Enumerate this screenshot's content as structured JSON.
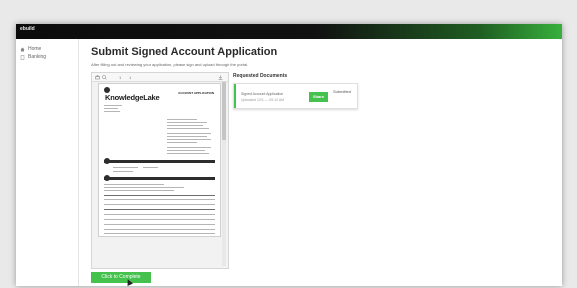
{
  "app": {
    "brand": "ebuild",
    "topbar_center": ""
  },
  "sidebar": {
    "items": [
      {
        "label": "Home",
        "icon": "home-icon"
      },
      {
        "label": "Banking",
        "icon": "document-icon"
      }
    ]
  },
  "page": {
    "title": "Submit Signed Account Application",
    "instructions": "After filling out and reviewing your application, please sign and upload through the portal."
  },
  "viewer": {
    "page_indicator": "1",
    "page_total": "1",
    "zoom": "",
    "toolbar_icons": [
      "print-icon",
      "search-icon",
      "download-icon"
    ]
  },
  "document": {
    "logo_text": "KnowledgeLake",
    "title": "ACCOUNT APPLICATION"
  },
  "requested_documents": {
    "title": "Requested Documents",
    "items": [
      {
        "name": "Signed Account Application",
        "sub": "Uploaded 12/1 — 09:12 AM",
        "share_label": "Share",
        "status": "Submitted"
      }
    ]
  },
  "actions": {
    "complete_label": "Click to Complete"
  },
  "colors": {
    "accent": "#45c14d",
    "topbar_dark": "#0c0c0c",
    "topbar_green": "#37b03c"
  }
}
